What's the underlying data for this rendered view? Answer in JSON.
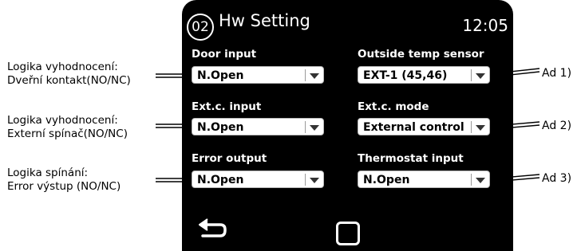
{
  "screen": {
    "number": "02",
    "title": "Hw Setting",
    "clock": "12:05",
    "fields": [
      {
        "label": "Door input",
        "value": "N.Open"
      },
      {
        "label": "Outside temp sensor",
        "value": "EXT-1 (45,46)"
      },
      {
        "label": "Ext.c. input",
        "value": "N.Open"
      },
      {
        "label": "Ext.c. mode",
        "value": "External control"
      },
      {
        "label": "Error output",
        "value": "N.Open"
      },
      {
        "label": "Thermostat input",
        "value": "N.Open"
      }
    ],
    "nav": {
      "back_icon": "back-arrow-icon",
      "home_icon": "square-icon"
    }
  },
  "annotations_left": [
    {
      "line1": "Logika vyhodnocení:",
      "line2": "Dveřní kontakt(NO/NC)"
    },
    {
      "line1": "Logika vyhodnocení:",
      "line2": "Externí spínač(NO/NC)"
    },
    {
      "line1": "Logika spínání:",
      "line2": "Error výstup (NO/NC)"
    }
  ],
  "annotations_right": [
    "Ad 1)",
    "Ad 2)",
    "Ad 3)"
  ]
}
